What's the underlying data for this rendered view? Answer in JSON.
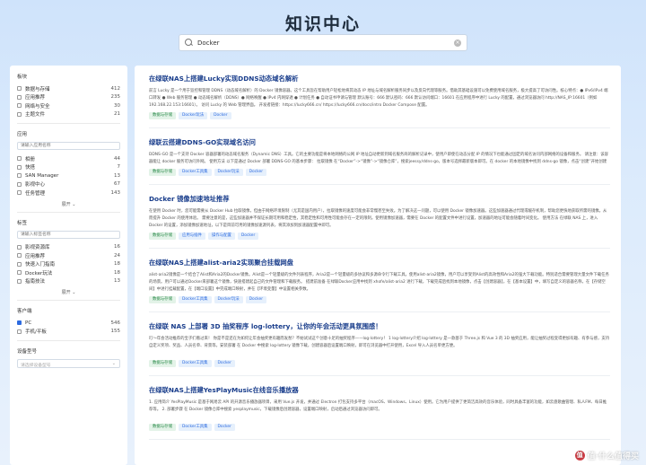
{
  "page_title": "知识中心",
  "search": {
    "value": "Docker",
    "icon": "search-icon"
  },
  "sidebar": {
    "category_title": "板块",
    "categories": [
      {
        "label": "数据与存储",
        "count": "412"
      },
      {
        "label": "应用推荐",
        "count": "235"
      },
      {
        "label": "网络与安全",
        "count": "30"
      },
      {
        "label": "主题文件",
        "count": "21"
      }
    ],
    "app_title": "应用",
    "app_search_placeholder": "请输入应用名称",
    "apps": [
      {
        "label": "相册",
        "count": "44"
      },
      {
        "label": "快搭",
        "count": "7"
      },
      {
        "label": "SAN Manager",
        "count": "13"
      },
      {
        "label": "影视中心",
        "count": "67"
      },
      {
        "label": "任务管理",
        "count": "143"
      }
    ],
    "apps_more": "展开",
    "tag_title": "标签",
    "tag_search_placeholder": "请输入标签名称",
    "tags": [
      {
        "label": "影视资源库",
        "count": "16"
      },
      {
        "label": "应用推荐",
        "count": "24"
      },
      {
        "label": "快速入门指南",
        "count": "18"
      },
      {
        "label": "Docker玩法",
        "count": "18"
      },
      {
        "label": "指南技法",
        "count": "13"
      }
    ],
    "tags_more": "展开",
    "client_title": "客户端",
    "clients": [
      {
        "label": "PC",
        "count": "546",
        "checked": true
      },
      {
        "label": "手机/平板",
        "count": "155",
        "checked": false
      }
    ],
    "device_title": "设备型号",
    "device_placeholder": "请选择设备型号"
  },
  "results": [
    {
      "title": "在绿联NAS上搭建Lucky实现DDNS动态域名解析",
      "snippet": "前言 Lucky 是一个用于监控和管理 DDNS（动态域名解析）的 Docker 镜像容器。这个工具旨在帮助用户轻松地将其动态 IP 地址与域名解析服务同步以及反向代理等服务。借助其基础设施可以免费使用域名服务，极大提高了可访问性。核心特点：● IPv6/IPv4 端口转发 ● Web 服务管理 ● 动态域名解析（DDNS）● 网络唤醒 ● IPv4 内网穿透 ● 计划任务 ● 自动证书申请与管理 默认账号：666 默认密码：666 默认访问端口：16601 在应用程序中进行 Lucky 的配置，通过浏览器访问 http://NAS_IP:16601（例如 192.168.22.153:16601）。 访问 Lucky 的 Web 管理界面。 开发者链接：https://lucky666.cn/ https://lucky666.cn/docs/intro Docker Compose 配置。",
      "tags": [
        {
          "label": "数据与存储",
          "color": "green"
        },
        {
          "label": "Docker玩法",
          "color": "blue"
        },
        {
          "label": "Docker",
          "color": "blue"
        }
      ]
    },
    {
      "title": "绿联云搭建DDNS-GO实现域名访问",
      "snippet": "DDNS-GO 是一个支持 Docker 容器部署的动态域名服务（Dynamic DNS）工具。它的主要功能是将本地网络的公网 IP 地址自动更新到域名服务商的解析记录中，使用户即使在动态分配 IP 的情况下也能通过固定的域名访问内部网络的设备和服务。 请注意：该容器能让 docker 服务可访问外网。 使用方法 以下是通过 Docker 部署 DDNS-GO 的基本步骤： 拉取镜像 在“Docker”->“镜像”->“镜像仓库”，搜索jeessy/ddns-go，版本号选择最新版本即可。在 docker 的本地镜像中找到 ddns-go 镜像，点击“创建”开始创建容器，端口：9876，网络：host，在对应设置下填写对应内容并启动容器，在本地浏览器中进入 NAS IP:9876 的管理界面完成配置与访问。",
      "tags": [
        {
          "label": "数据与存储",
          "color": "green"
        },
        {
          "label": "Docker工具集",
          "color": "blue"
        },
        {
          "label": "Docker玩法",
          "color": "blue"
        },
        {
          "label": "Docker",
          "color": "blue"
        }
      ]
    },
    {
      "title": "Docker 镜像加速地址推荐",
      "snippet": "在使用 Docker 时，您可能需要从 Docker Hub 拉取镜像，但由于网络环境限制（尤其是国内用户），拉取镜像的速度可能会非常慢甚至失败。为了解决这一问题，可以使用 Docker 镜像加速器。这些加速器通过代理或缓存机制，帮助您更快地获取所需的镜像。从而提升 Docker 的使用体验。 需要注意的是，这些加速器并不保证长期可用和稳定性，其稳定性和可用性可能会存在一定的限制。使用镜像加速器，需要在 Docker 的配置文件中进行设置，加速器的地址可能会随着时间变化。 使用方法 在绿联 NAS 上，进入 Docker 的设置，添加镜像加速地址，以下是目前可用的镜像加速源列表，将其添加到加速器配置中即可。",
      "tags": [
        {
          "label": "数据与存储",
          "color": "green"
        },
        {
          "label": "应用与插件",
          "color": "blue"
        },
        {
          "label": "操作与配置",
          "color": "blue"
        },
        {
          "label": "Docker",
          "color": "blue"
        }
      ]
    },
    {
      "title": "在绿联NAS上搭建alist-aria2实现聚合挂载网盘",
      "snippet": "alist-aria2镜像是一个结合了Alist和Aria2的Docker镜像。Alist是一个轻量级的文件列表程序，Aria2是一个轻量级的多协议和多源命令行下载工具。使用alist-aria2镜像，用户可以享受到Alist的高效性和Aria2的强大下载功能。特别适合需要管理大量文件下载任务的场景。用户可以通过Docker来部署这个镜像，快速搭建起自己的文件管理和下载服务。 搭建前准备 在绿联Docker应用中找到 xhofe/alist-aria2 进行下载，下载完成后找到本地镜像，点击【创建容器】，在【基本设置】中，填写自定义的容器名称，在【存储空间】中进行挂载配置，在【端口设置】中完成端口映射，并在【环境变量】中设置相关参数。",
      "tags": [
        {
          "label": "数据与存储",
          "color": "green"
        },
        {
          "label": "Docker工具集",
          "color": "blue"
        },
        {
          "label": "Docker玩法",
          "color": "blue"
        },
        {
          "label": "Docker",
          "color": "blue"
        }
      ]
    },
    {
      "title": "在绿联 NAS 上部署 3D 抽奖程序 log-lottery，让你的年会活动更具氛围感！",
      "snippet": "叮～年会活动推荐的宝子们看过来！ 你是不是还在为如何让年会抽奖更有趣而发愁？不妨试试这个创意十足的抽奖程序——log-lottery！ 1 log-lottery介绍 log-lottery 是一款基于 Three.js 和 Vue 3 的 3D 抽奖应用，能让抽奖过程变得更加有趣、有参与感，支持自定义奖项、奖品、人员名单、背景等。安装部署 在 Docker 中搜索 log-lottery 镜像下载，创建容器后设置端口映射，即可在浏览器中打开使用，Excel 导入人员名单更方便。",
      "tags": [
        {
          "label": "数据与存储",
          "color": "green"
        },
        {
          "label": "Docker工具集",
          "color": "blue"
        },
        {
          "label": "Docker",
          "color": "blue"
        }
      ]
    },
    {
      "title": "在绿联NAS上搭建YesPlayMusic在线音乐播放器",
      "snippet": "1. 应用简介 YesPlayMusic 是基于网易云 API 的开源音乐播放器项目，采用 Vue.js 开发，并通过 Electron 打包支持多平台（macOS、Windows、Linux）使用。它为用户提供了更简洁高效的音乐体验，同时具备丰富的功能，如云盘歌曲管理、私人FM、每日推荐等。 2. 部署步骤 在 Docker 镜像仓库中搜索 yesplaymusic，下载镜像后创建容器，设置端口映射，启动后通过浏览器访问即可。",
      "tags": [
        {
          "label": "数据与存储",
          "color": "green"
        },
        {
          "label": "Docker工具集",
          "color": "blue"
        },
        {
          "label": "Docker",
          "color": "blue"
        }
      ]
    }
  ],
  "watermark": {
    "text": "值·什么值得买",
    "logo": "值"
  }
}
